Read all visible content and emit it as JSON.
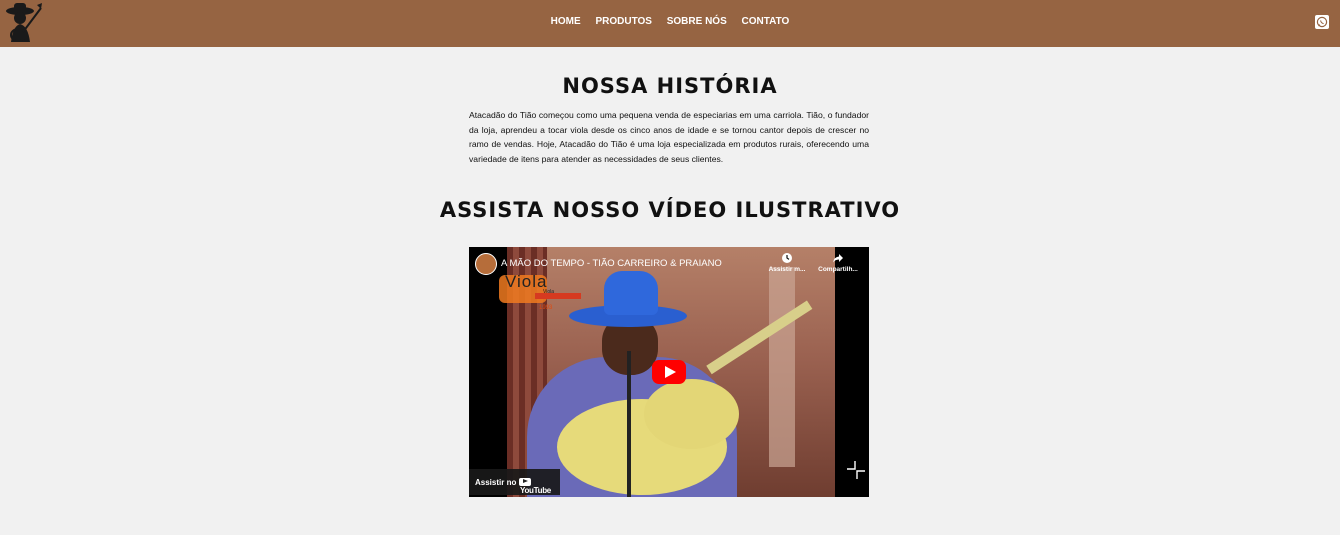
{
  "nav": {
    "items": [
      {
        "label": "HOME"
      },
      {
        "label": "PRODUTOS"
      },
      {
        "label": "SOBRE NÓS"
      },
      {
        "label": "CONTATO"
      }
    ],
    "logo_icon": "cowboy-guitar-logo",
    "social_icon": "whatsapp-icon"
  },
  "history": {
    "title": "NOSSA HISTÓRIA",
    "text": "Atacadão do Tião começou como uma pequena venda de especiarias em uma carriola. Tião, o fundador da loja, aprendeu a tocar viola desde os cinco anos de idade e se tornou cantor depois de crescer no ramo de vendas. Hoje, Atacadão do Tião é uma loja especializada em produtos rurais, oferecendo uma variedade de itens para atender as necessidades de seus clientes."
  },
  "video_section": {
    "title": "ASSISTA NOSSO VÍDEO ILUSTRATIVO"
  },
  "video": {
    "name": "A MÃO DO TEMPO - TIÃO CARREIRO & PRAIANO",
    "watch_later": "Assistir m...",
    "share": "Compartilh...",
    "watch_on": "Assistir no",
    "youtube": "YouTube",
    "overlay_brand": "Viola",
    "overlay_sub": "Viola",
    "overlay_year": "1993",
    "colors": {
      "play": "#ff0000",
      "navbar": "#966442"
    }
  }
}
